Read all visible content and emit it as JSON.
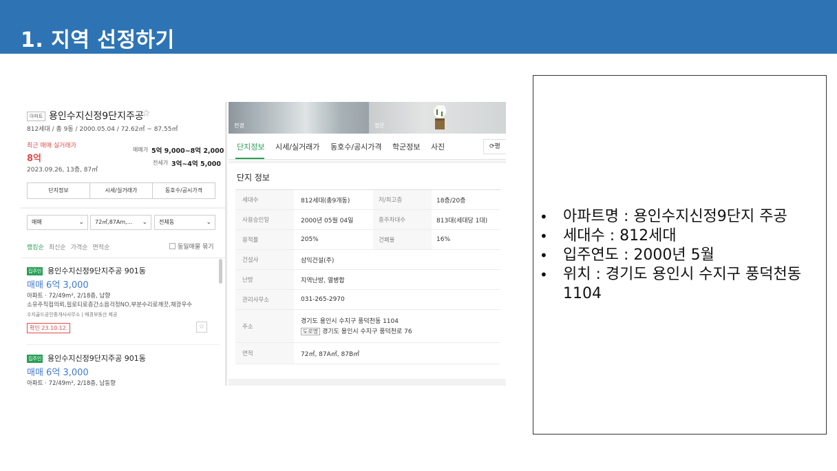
{
  "slide": {
    "title": "1. 지역 선정하기"
  },
  "left_panel": {
    "badge": "아파트",
    "apt_name": "용인수지신정9단지주공",
    "star": "☆",
    "summary": "812세대 / 총 9동 / 2000.05.04 / 72.62㎡ ~ 87.55㎡",
    "recent_label": "최근 매매 실거래가",
    "recent_price": "8억",
    "recent_date": "2023.09.26, 13층, 87㎡",
    "trade_label": "매매가",
    "trade_value": "5억 9,000~8억 2,000",
    "jeonse_label": "전세가",
    "jeonse_value": "3억~4억 5,000",
    "tabs": [
      "단지정보",
      "시세/실거래가",
      "동호수/공시가격"
    ],
    "selects": [
      {
        "value": "매매"
      },
      {
        "value": "72㎡,87Am,..."
      },
      {
        "value": "전체동"
      }
    ],
    "sorts": [
      "랭킹순",
      "최신순",
      "가격순",
      "면적순"
    ],
    "no_group": "동일매물 묶기",
    "listings": [
      {
        "tag": "집주인",
        "name": "용인수지신정9단지주공 901동",
        "price": "매매 6억 3,000",
        "info": "아파트 · 72/49m², 2/18층, 남향",
        "desc": "소유주직접의뢰,필로티로층간소음걱정NO,부분수리로깨끗,채광우수",
        "agent": "수지골드공인중개사사무소 | 매경부동산 제공",
        "confirm": "확인 23.10.12."
      },
      {
        "tag": "집주인",
        "name": "용인수지신정9단지주공 901동",
        "price": "매매 6억 3,000",
        "info": "아파트 · 72/49m², 2/18층, 남동향"
      }
    ]
  },
  "right_panel": {
    "photo_labels": [
      "전경",
      "정문"
    ],
    "tabs": [
      "단지정보",
      "시세/실거래가",
      "동호수/공시가격",
      "학군정보",
      "사진"
    ],
    "refresh": "평",
    "section_title": "단지 정보",
    "rows": [
      {
        "k": "세대수",
        "v": "812세대(총9개동)",
        "k2": "저/최고층",
        "v2": "18층/20층"
      },
      {
        "k": "사용승인일",
        "v": "2000년 05월 04일",
        "k2": "총주차대수",
        "v2": "813대(세대당 1대)"
      },
      {
        "k": "용적률",
        "v": "205%",
        "k2": "건폐율",
        "v2": "16%"
      },
      {
        "k": "건설사",
        "v": "삼익건설(주)"
      },
      {
        "k": "난방",
        "v": "지역난방, 열병합"
      },
      {
        "k": "관리사무소",
        "v": "031-265-2970"
      }
    ],
    "address": {
      "label": "주소",
      "line1": "경기도 용인시 수지구 풍덕천동 1104",
      "road_tag": "도로명",
      "line2": "경기도 용인시 수지구 풍덕천로 76"
    },
    "area": {
      "k": "면적",
      "v": "72㎡, 87A㎡, 87B㎡"
    }
  },
  "info_box": {
    "items": [
      "아파트명 : 용인수지신정9단지 주공",
      "세대수 : 812세대",
      "입주연도 : 2000년 5월",
      "위치 : 경기도 용인시 수지구 풍덕천동 1104"
    ]
  }
}
